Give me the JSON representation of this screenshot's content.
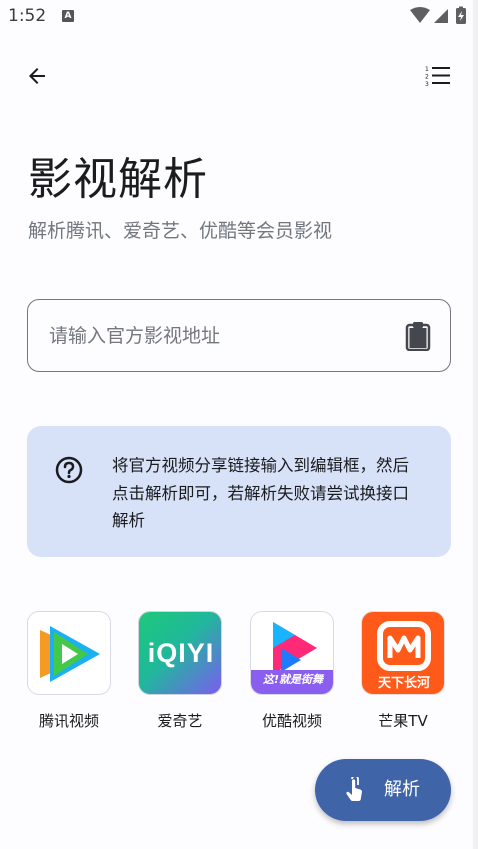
{
  "status_bar": {
    "time": "1:52",
    "notification_badge": "A"
  },
  "top_bar": {
    "back_icon": "arrow-left-icon",
    "menu_icon": "numbered-list-icon"
  },
  "header": {
    "title": "影视解析",
    "subtitle": "解析腾讯、爱奇艺、优酷等会员影视"
  },
  "url_input": {
    "placeholder": "请输入官方影视地址",
    "value": "",
    "paste_icon": "clipboard-icon"
  },
  "info_card": {
    "icon": "help-circle-icon",
    "text": "将官方视频分享链接输入到编辑框，然后点击解析即可，若解析失败请尝试换接口解析"
  },
  "apps": [
    {
      "label": "腾讯视频",
      "icon": "tencent-video-logo"
    },
    {
      "label": "爱奇艺",
      "icon": "iqiyi-logo",
      "logo_text": "iQIYI"
    },
    {
      "label": "优酷视频",
      "icon": "youku-logo",
      "logo_text": "这!就是街舞"
    },
    {
      "label": "芒果TV",
      "icon": "mango-tv-logo",
      "logo_text": "天下长河"
    }
  ],
  "fab": {
    "label": "解析",
    "icon": "touch-hand-icon"
  },
  "colors": {
    "primary": "#3f64a8",
    "card_bg": "#d7e2f8",
    "outline": "#74777f",
    "background": "#fdfcff"
  }
}
